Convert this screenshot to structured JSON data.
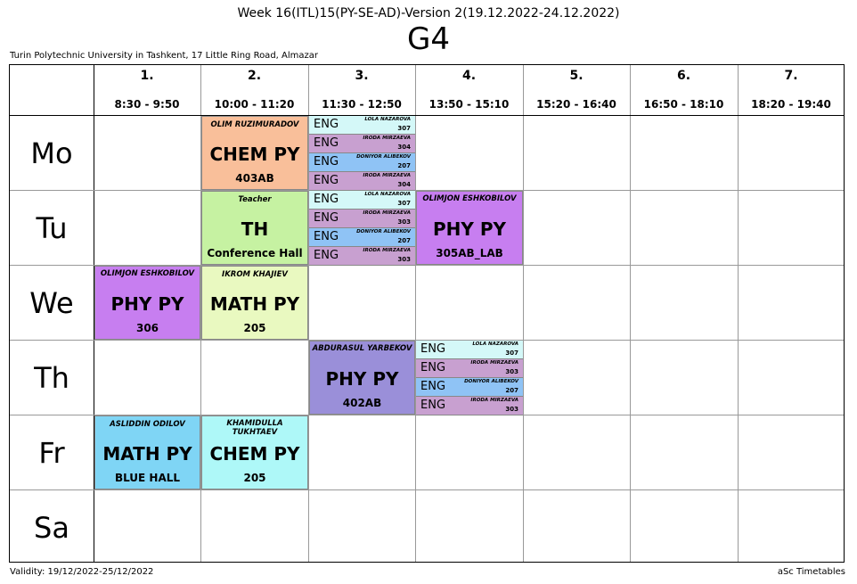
{
  "header": {
    "week": "Week 16(ITL)15(PY-SE-AD)-Version 2(19.12.2022-24.12.2022)",
    "group": "G4",
    "school": "Turin Polytechnic University in Tashkent, 17 Little Ring Road, Almazar"
  },
  "footer": {
    "validity": "Validity: 19/12/2022-25/12/2022",
    "brand": "aSc Timetables"
  },
  "periods": [
    {
      "num": "1.",
      "time": "8:30 - 9:50"
    },
    {
      "num": "2.",
      "time": "10:00 - 11:20"
    },
    {
      "num": "3.",
      "time": "11:30 - 12:50"
    },
    {
      "num": "4.",
      "time": "13:50 - 15:10"
    },
    {
      "num": "5.",
      "time": "15:20 - 16:40"
    },
    {
      "num": "6.",
      "time": "16:50 - 18:10"
    },
    {
      "num": "7.",
      "time": "18:20 - 19:40"
    }
  ],
  "days": [
    "Mo",
    "Tu",
    "We",
    "Th",
    "Fr",
    "Sa"
  ],
  "lessons": [
    {
      "teacher": "OLIM RUZIMURADOV",
      "subject": "CHEM PY",
      "room": "403AB",
      "color": "#f9bf9a"
    },
    {
      "teacher": "Teacher",
      "subject": "TH",
      "room": "Conference Hall",
      "color": "#c6f2a2"
    },
    {
      "teacher": "OLIMJON ESHKOBILOV",
      "subject": "PHY PY",
      "room": "305AB_LAB",
      "color": "#c77ef0"
    },
    {
      "teacher": "OLIMJON ESHKOBILOV",
      "subject": "PHY PY",
      "room": "306",
      "color": "#c77ef0"
    },
    {
      "teacher": "IKROM KHAJIEV",
      "subject": "MATH PY",
      "room": "205",
      "color": "#e9f9c0"
    },
    {
      "teacher": "ABDURASUL YARBEKOV",
      "subject": "PHY PY",
      "room": "402AB",
      "color": "#9a8fd9"
    },
    {
      "teacher": "ASLIDDIN ODILOV",
      "subject": "MATH PY",
      "room": "BLUE HALL",
      "color": "#7fd5f5"
    },
    {
      "teacher": "KHAMIDULLA TUKHTAEV",
      "subject": "CHEM PY",
      "room": "205",
      "color": "#aef8f8"
    }
  ],
  "english_blocks": [
    [
      {
        "label": "ENG",
        "teacher": "LOLA NAZAROVA",
        "room": "307",
        "color": "#d4f8f8"
      },
      {
        "label": "ENG",
        "teacher": "IRODA MIRZAEVA",
        "room": "304",
        "color": "#c8a0d0"
      },
      {
        "label": "ENG",
        "teacher": "DONIYOR ALIBEKOV",
        "room": "207",
        "color": "#8fc3f5"
      },
      {
        "label": "ENG",
        "teacher": "IRODA MIRZAEVA",
        "room": "304",
        "color": "#c8a0d0"
      }
    ],
    [
      {
        "label": "ENG",
        "teacher": "LOLA NAZAROVA",
        "room": "307",
        "color": "#d4f8f8"
      },
      {
        "label": "ENG",
        "teacher": "IRODA MIRZAEVA",
        "room": "303",
        "color": "#c8a0d0"
      },
      {
        "label": "ENG",
        "teacher": "DONIYOR ALIBEKOV",
        "room": "207",
        "color": "#8fc3f5"
      },
      {
        "label": "ENG",
        "teacher": "IRODA MIRZAEVA",
        "room": "303",
        "color": "#c8a0d0"
      }
    ],
    [
      {
        "label": "ENG",
        "teacher": "LOLA NAZAROVA",
        "room": "307",
        "color": "#d4f8f8"
      },
      {
        "label": "ENG",
        "teacher": "IRODA MIRZAEVA",
        "room": "303",
        "color": "#c8a0d0"
      },
      {
        "label": "ENG",
        "teacher": "DONIYOR ALIBEKOV",
        "room": "207",
        "color": "#8fc3f5"
      },
      {
        "label": "ENG",
        "teacher": "IRODA MIRZAEVA",
        "room": "303",
        "color": "#c8a0d0"
      }
    ]
  ]
}
